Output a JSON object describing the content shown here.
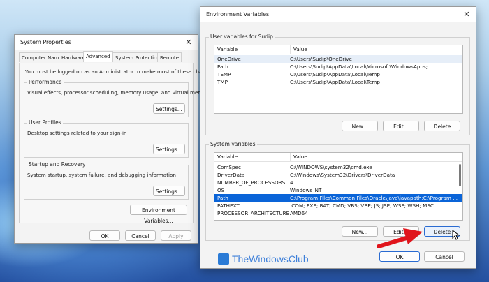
{
  "watermark": {
    "brand": "TheWindowsClub"
  },
  "system_properties": {
    "title": "System Properties",
    "tabs": [
      "Computer Name",
      "Hardware",
      "Advanced",
      "System Protection",
      "Remote"
    ],
    "active_tab": "Advanced",
    "admin_note": "You must be logged on as an Administrator to make most of these changes.",
    "performance": {
      "label": "Performance",
      "desc": "Visual effects, processor scheduling, memory usage, and virtual memory",
      "button": "Settings..."
    },
    "user_profiles": {
      "label": "User Profiles",
      "desc": "Desktop settings related to your sign-in",
      "button": "Settings..."
    },
    "startup_recovery": {
      "label": "Startup and Recovery",
      "desc": "System startup, system failure, and debugging information",
      "button": "Settings..."
    },
    "env_button": "Environment Variables...",
    "ok": "OK",
    "cancel": "Cancel",
    "apply": "Apply"
  },
  "env_vars": {
    "title": "Environment Variables",
    "user_section": "User variables for Sudip",
    "col_variable": "Variable",
    "col_value": "Value",
    "user_rows": [
      {
        "variable": "OneDrive",
        "value": "C:\\Users\\Sudip\\OneDrive"
      },
      {
        "variable": "Path",
        "value": "C:\\Users\\Sudip\\AppData\\Local\\Microsoft\\WindowsApps;"
      },
      {
        "variable": "TEMP",
        "value": "C:\\Users\\Sudip\\AppData\\Local\\Temp"
      },
      {
        "variable": "TMP",
        "value": "C:\\Users\\Sudip\\AppData\\Local\\Temp"
      }
    ],
    "user_buttons": {
      "new": "New...",
      "edit": "Edit...",
      "delete": "Delete"
    },
    "system_section": "System variables",
    "system_rows": [
      {
        "variable": "ComSpec",
        "value": "C:\\WINDOWS\\system32\\cmd.exe"
      },
      {
        "variable": "DriverData",
        "value": "C:\\Windows\\System32\\Drivers\\DriverData"
      },
      {
        "variable": "NUMBER_OF_PROCESSORS",
        "value": "4"
      },
      {
        "variable": "OS",
        "value": "Windows_NT"
      },
      {
        "variable": "Path",
        "value": "C:\\Program Files\\Common Files\\Oracle\\Java\\javapath;C:\\Program ..."
      },
      {
        "variable": "PATHEXT",
        "value": ".COM;.EXE;.BAT;.CMD;.VBS;.VBE;.JS;.JSE;.WSF;.WSH;.MSC"
      },
      {
        "variable": "PROCESSOR_ARCHITECTURE",
        "value": "AMD64"
      }
    ],
    "system_selected_index": 4,
    "system_buttons": {
      "new": "New...",
      "edit": "Edit...",
      "delete": "Delete"
    },
    "ok": "OK",
    "cancel": "Cancel"
  },
  "colors": {
    "selection": "#0a64d8",
    "arrow": "#e0141b",
    "primary_border": "#2a6bd1"
  }
}
